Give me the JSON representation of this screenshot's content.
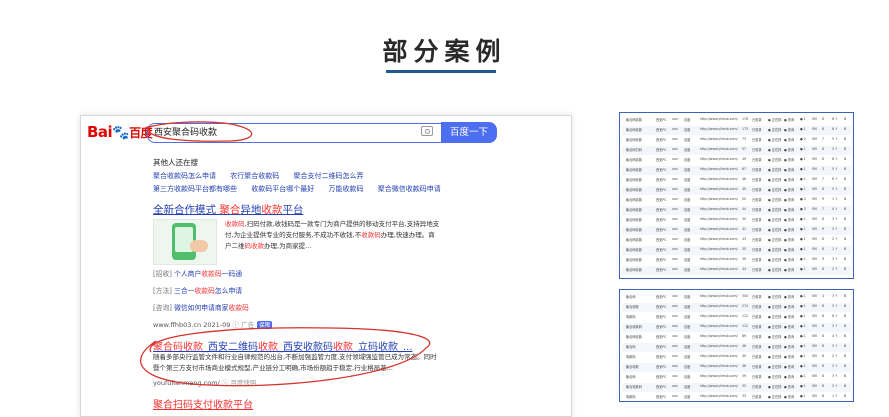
{
  "heading": {
    "title": "部分案例"
  },
  "baidu": {
    "logo": {
      "bai": "Bai",
      "paw": "🐾",
      "du": "百度"
    },
    "search": {
      "value": "西安聚合码收款",
      "button_label": "百度一下"
    },
    "related": {
      "title": "其他人还在搜",
      "row1": [
        "聚合收款码怎么申请",
        "农行聚合收款码",
        "聚合支付二维码怎么弄"
      ],
      "row2": [
        "第三方收款码平台都有哪些",
        "收款码平台哪个最好",
        "万能收款码",
        "聚合微信收款码申请"
      ]
    },
    "result1": {
      "title_pre": "全新合作模式 ",
      "title_hl1": "聚合",
      "title_mid": "异地",
      "title_hl2": "收款",
      "title_post": "平台",
      "desc_hl1": "收款码",
      "desc_a": ",扫码付款,收钱码是一款专门为商户提供的移动支付平台,支持异地支付,为企业提供专业的支付服务,不成功不收钱,不",
      "desc_hl2": "收款码",
      "desc_b": "办理,快速办理。商户二维",
      "desc_hl3": "码收款",
      "desc_c": "办理,为商家提...",
      "sublinks": [
        {
          "tag": "[招收]",
          "pre": " 个人商户",
          "hl": "收款码",
          "post": "一码通"
        },
        {
          "tag": "[方法]",
          "pre": " 三合一",
          "hl": "收款码",
          "post": "怎么申请"
        },
        {
          "tag": "[咨询]",
          "pre": " 微信如何申请商家",
          "hl": "收款码",
          "post": ""
        }
      ],
      "url": "www.ffhb03.cn 2021-09",
      "ad_label": "广告",
      "badge": "保障"
    },
    "result2": {
      "title_hl1": "聚合码收款",
      "title_a": "_西安二维码",
      "title_hl2": "收款",
      "title_b": "_西安收款码",
      "title_hl3": "收款",
      "title_c": "_立码收款_...",
      "desc": "随着多部央行监管文件和行业自律规范的出台,不断加强监管力度,支付领域强监管已成为常态。同时暨个第三方支付市场商业模式规型,产业链分工明确,市场份额趋于稳定,行业格局基...",
      "url": "youfulianmeng.com/",
      "snapshot": "百度快照"
    },
    "result3": {
      "title": "聚合扫码支付收款平台"
    }
  },
  "tables": [
    {
      "rows": [
        [
          "聚合码收款",
          "西安PC",
          "xxx",
          "百度",
          "http://www.yllmsb.com/",
          "176",
          "已收录",
          "● 正在排",
          "● 查询",
          "● 1",
          "SM",
          "8",
          "8 ↑",
          "B"
        ],
        [
          "聚合码收款",
          "西安PC",
          "xxx",
          "百度",
          "http://www.yllmsb.com/",
          "173",
          "已收录",
          "● 正在排",
          "● 查询",
          "● 1",
          "SM",
          "8",
          "8 ↑",
          "B"
        ],
        [
          "聚合码收款",
          "西安PC",
          "xxx",
          "百度",
          "http://www.yllmsb.com/",
          "73",
          "已收录",
          "● 正在排",
          "● 查询",
          "● 2",
          "SM",
          "7",
          "5 ↑",
          "B"
        ],
        [
          "聚合码扫码",
          "西安PC",
          "xxx",
          "百度",
          "http://www.yllmsb.com/",
          "57",
          "已收录",
          "● 正在排",
          "● 查询",
          "● 1",
          "SM",
          "8",
          "3 ↑",
          "B"
        ],
        [
          "聚合码收款",
          "西安PC",
          "xxx",
          "百度",
          "http://www.yllmsb.com/",
          "49",
          "已收录",
          "● 正在排",
          "● 查询",
          "● 1",
          "SM",
          "8",
          "8 ↑",
          "B"
        ],
        [
          "聚合码收款",
          "西安PC",
          "xxx",
          "百度",
          "http://www.yllmsb.com/",
          "67",
          "已收录",
          "● 正在排",
          "● 查询",
          "● 1",
          "SM",
          "3",
          "5 ↑",
          "B"
        ],
        [
          "聚合码收款",
          "西安PC",
          "xxx",
          "百度",
          "http://www.yllmsb.com/",
          "48",
          "已收录",
          "● 正在排",
          "● 查询",
          "● 1",
          "SM",
          "7",
          "6 ↑",
          "B"
        ],
        [
          "聚合码收款",
          "西安PC",
          "xxx",
          "百度",
          "http://www.yllmsb.com/",
          "40",
          "已收录",
          "● 正在排",
          "● 查询",
          "● 1",
          "SM",
          "8",
          "5 ↑",
          "B"
        ],
        [
          "聚合码收款",
          "西安PC",
          "xxx",
          "百度",
          "http://www.yllmsb.com/",
          "50",
          "已收录",
          "● 正在排",
          "● 查询",
          "● 2",
          "SM",
          "9",
          "1 ↑",
          "B"
        ],
        [
          "聚合码收款",
          "西安PC",
          "xxx",
          "百度",
          "http://www.yllmsb.com/",
          "44",
          "已收录",
          "● 正在排",
          "● 查询",
          "● 3",
          "SM",
          "7",
          "4 ↑",
          "B"
        ],
        [
          "聚合码收款",
          "西安PC",
          "xxx",
          "百度",
          "http://www.yllmsb.com/",
          "30",
          "已收录",
          "● 正在排",
          "● 查询",
          "● 1",
          "SM",
          "8",
          "3 ↑",
          "B"
        ],
        [
          "聚合码收款",
          "西安PC",
          "xxx",
          "百度",
          "http://www.yllmsb.com/",
          "41",
          "已收录",
          "● 正在排",
          "● 查询",
          "● 1",
          "SM",
          "9",
          "3 ↑",
          "B"
        ],
        [
          "聚合码收款",
          "西安PC",
          "xxx",
          "百度",
          "http://www.yllmsb.com/",
          "43",
          "已收录",
          "● 正在排",
          "● 查询",
          "● 1",
          "SM",
          "8",
          "2 ↑",
          "B"
        ],
        [
          "聚合码收款",
          "西安PC",
          "xxx",
          "百度",
          "http://www.yllmsb.com/",
          "35",
          "已收录",
          "● 正在排",
          "● 查询",
          "● 1",
          "SM",
          "8",
          "1 ↑",
          "B"
        ],
        [
          "聚合码收款",
          "西安PC",
          "xxx",
          "百度",
          "http://www.yllmsb.com/",
          "39",
          "已收录",
          "● 正在排",
          "● 查询",
          "● 1",
          "SM",
          "9",
          "3 ↑",
          "B"
        ],
        [
          "聚合码收款",
          "西安PC",
          "xxx",
          "百度",
          "http://www.yllmsb.com/",
          "44",
          "已收录",
          "● 正在排",
          "● 查询",
          "● 1",
          "SM",
          "8",
          "2 ↑",
          "B"
        ]
      ]
    },
    {
      "rows": [
        [
          "聚合码",
          "西安PC",
          "xxx",
          "百度",
          "http://www.yllmsb.com/",
          "304",
          "已收录",
          "● 正在排",
          "● 查询",
          "● 1",
          "SM",
          "4",
          "3 ↑",
          "B"
        ],
        [
          "聚合收款",
          "西安PC",
          "xxx",
          "百度",
          "http://www.yllmsb.com/",
          "274",
          "已收录",
          "● 正在排",
          "● 查询",
          "● 1",
          "SM",
          "8",
          "3 ↑",
          "B"
        ],
        [
          "收款码",
          "西安PC",
          "xxx",
          "百度",
          "http://www.yllmsb.com/",
          "112",
          "已收录",
          "● 正在排",
          "● 查询",
          "● 1",
          "SM",
          "8",
          "8 ↑",
          "B"
        ],
        [
          "聚合收款码",
          "西安PC",
          "xxx",
          "百度",
          "http://www.yllmsb.com/",
          "112",
          "已收录",
          "● 正在排",
          "● 查询",
          "● 1",
          "SM",
          "8",
          "3 ↑",
          "B"
        ],
        [
          "聚合码收款",
          "西安PC",
          "xxx",
          "百度",
          "http://www.yllmsb.com/",
          "89",
          "已收录",
          "● 正在排",
          "● 查询",
          "● 1",
          "SM",
          "8",
          "4 ↑",
          "B"
        ],
        [
          "聚合码",
          "西安PC",
          "xxx",
          "百度",
          "http://www.yllmsb.com/",
          "46",
          "已收录",
          "● 正在排",
          "● 查询",
          "● 1",
          "SM",
          "8",
          "3 ↑",
          "B"
        ],
        [
          "收款码",
          "西安PC",
          "xxx",
          "百度",
          "http://www.yllmsb.com/",
          "40",
          "已收录",
          "● 正在排",
          "● 查询",
          "● 1",
          "SM",
          "8",
          "2 ↑",
          "B"
        ],
        [
          "聚合收款",
          "西安PC",
          "xxx",
          "百度",
          "http://www.yllmsb.com/",
          "46",
          "已收录",
          "● 正在排",
          "● 查询",
          "● 1",
          "SM",
          "8",
          "2 ↑",
          "B"
        ],
        [
          "聚合码",
          "西安PC",
          "xxx",
          "百度",
          "http://www.yllmsb.com/",
          "39",
          "已收录",
          "● 正在排",
          "● 查询",
          "● 1",
          "SM",
          "8",
          "3 ↑",
          "B"
        ],
        [
          "聚合收款码",
          "西安PC",
          "xxx",
          "百度",
          "http://www.yllmsb.com/",
          "35",
          "已收录",
          "● 正在排",
          "● 查询",
          "● 1",
          "SM",
          "8",
          "2 ↑",
          "B"
        ],
        [
          "收款码",
          "西安PC",
          "xxx",
          "百度",
          "http://www.yllmsb.com/",
          "33",
          "已收录",
          "● 正在排",
          "● 查询",
          "● 1",
          "SM",
          "8",
          "1 ↑",
          "B"
        ],
        [
          "聚合码",
          "西安PC",
          "xxx",
          "百度",
          "http://www.yllmsb.com/",
          "31",
          "已收录",
          "● 正在排",
          "● 查询",
          "● 1",
          "SM",
          "8",
          "2 ↑",
          "B"
        ]
      ]
    }
  ],
  "colors": {
    "accent": "#1f5a93",
    "baidu_blue": "#4e6ef2",
    "link": "#2440b3",
    "highlight": "#f73131",
    "annotation": "#d4342c"
  }
}
